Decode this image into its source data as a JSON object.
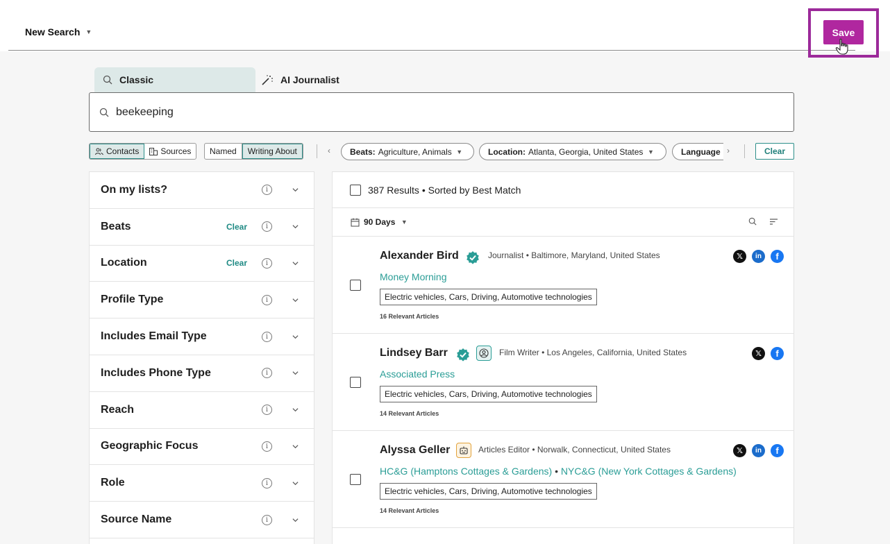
{
  "header": {
    "title": "New Search",
    "save_label": "Save"
  },
  "mode_tabs": [
    {
      "label": "Classic",
      "active": true
    },
    {
      "label": "AI Journalist",
      "active": false
    }
  ],
  "search": {
    "value": "beekeeping"
  },
  "toggles": {
    "contacts": "Contacts",
    "sources": "Sources",
    "named": "Named",
    "writing_about": "Writing About"
  },
  "chips": [
    {
      "key": "Beats:",
      "value": "Agriculture, Animals"
    },
    {
      "key": "Location:",
      "value": "Atlanta, Georgia, United States"
    },
    {
      "key": "Language",
      "value": ""
    }
  ],
  "clear_all_label": "Clear",
  "filters": [
    {
      "label": "On my lists?",
      "clear": ""
    },
    {
      "label": "Beats",
      "clear": "Clear"
    },
    {
      "label": "Location",
      "clear": "Clear"
    },
    {
      "label": "Profile Type",
      "clear": ""
    },
    {
      "label": "Includes Email Type",
      "clear": ""
    },
    {
      "label": "Includes Phone Type",
      "clear": ""
    },
    {
      "label": "Reach",
      "clear": ""
    },
    {
      "label": "Geographic Focus",
      "clear": ""
    },
    {
      "label": "Role",
      "clear": ""
    },
    {
      "label": "Source Name",
      "clear": ""
    }
  ],
  "results": {
    "summary": "387 Results • Sorted by Best Match",
    "date_range": "90 Days",
    "items": [
      {
        "name": "Alexander Bird",
        "meta": "Journalist • Baltimore, Maryland, United States",
        "outlets": [
          "Money Morning"
        ],
        "topics": "Electric vehicles, Cars, Driving, Automotive technologies",
        "relevant": "16 Relevant Articles",
        "socials": [
          "x",
          "linkedin",
          "facebook"
        ]
      },
      {
        "name": "Lindsey Barr",
        "meta": "Film Writer •  Los Angeles, California, United States",
        "outlets": [
          "Associated Press"
        ],
        "topics": "Electric vehicles, Cars, Driving, Automotive technologies",
        "relevant": "14 Relevant Articles",
        "socials": [
          "x",
          "facebook"
        ]
      },
      {
        "name": "Alyssa Geller",
        "meta": "Articles Editor • Norwalk, Connecticut, United States",
        "outlets": [
          "HC&G (Hamptons Cottages & Gardens)",
          "NYC&G (New York Cottages & Gardens)"
        ],
        "topics": "Electric vehicles, Cars, Driving, Automotive technologies",
        "relevant": "14 Relevant Articles",
        "socials": [
          "x",
          "linkedin",
          "facebook"
        ]
      }
    ]
  },
  "colors": {
    "brand_save": "#b0279f",
    "highlight_frame": "#9c2a9a",
    "teal_accent": "#2a9d96",
    "active_tab_bg": "#dde9e8"
  }
}
